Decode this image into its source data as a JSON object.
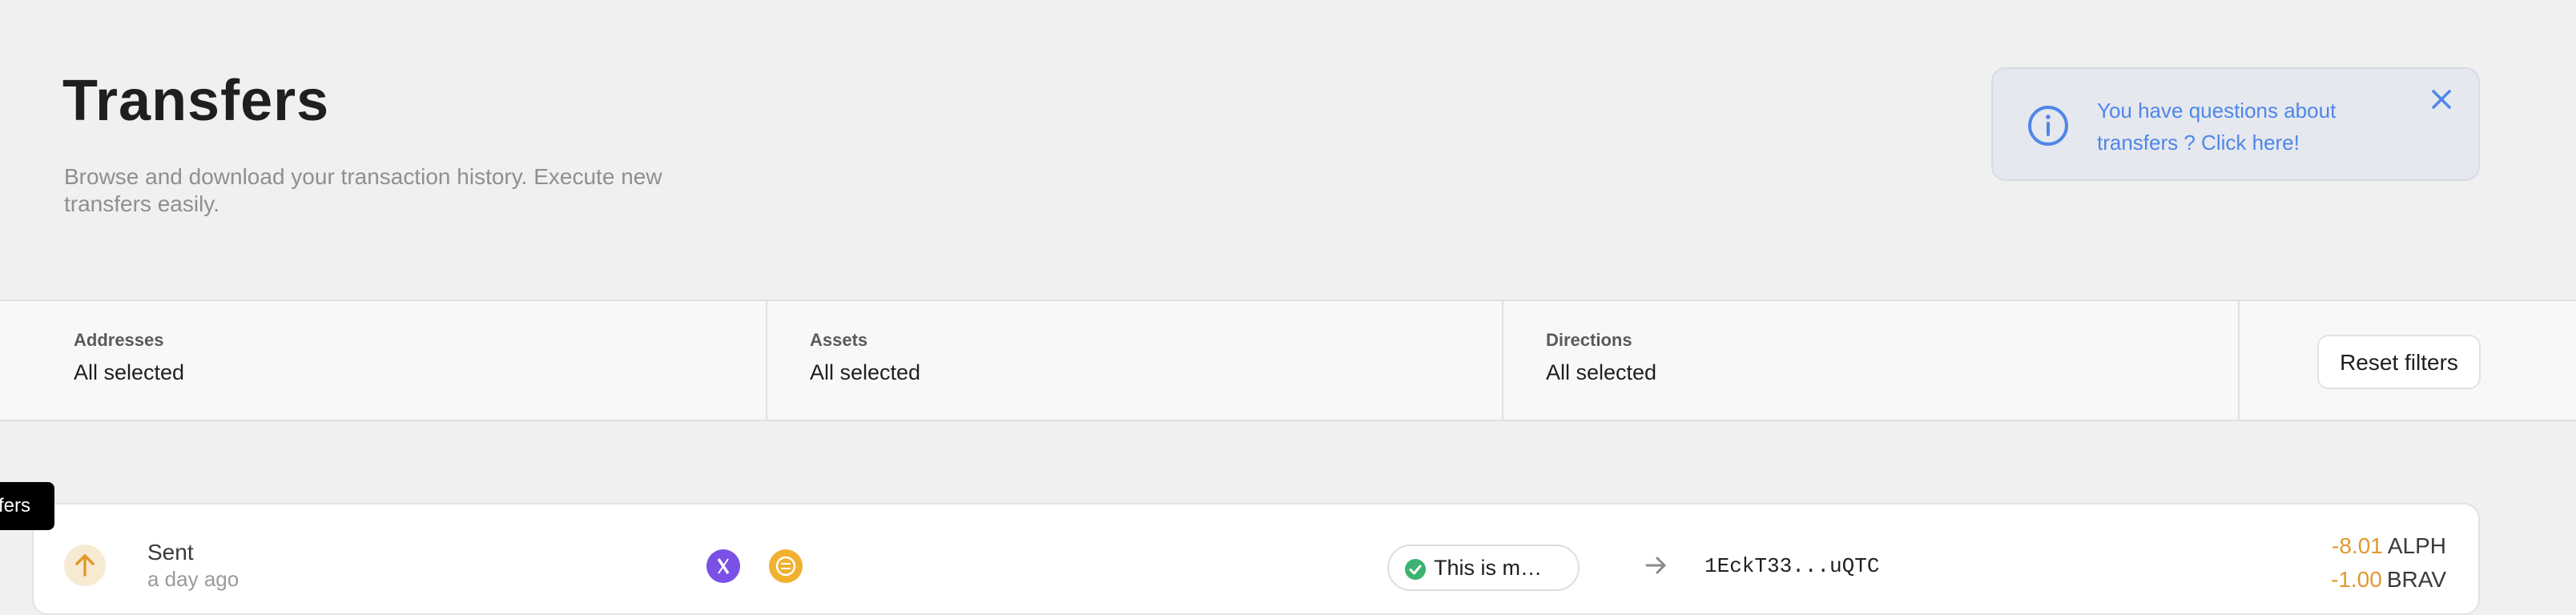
{
  "header": {
    "title": "Transfers",
    "subtitle": "Browse and download your transaction history. Execute new transfers easily."
  },
  "info_banner": {
    "text": "You have questions about transfers ? Click here!",
    "accent_color": "#4f86e8"
  },
  "filters": {
    "addresses": {
      "label": "Addresses",
      "value": "All selected"
    },
    "assets": {
      "label": "Assets",
      "value": "All selected"
    },
    "directions": {
      "label": "Directions",
      "value": "All selected"
    },
    "reset_label": "Reset filters"
  },
  "tooltip": {
    "text": "fers"
  },
  "transfers": [
    {
      "direction": "Sent",
      "time": "a day ago",
      "direction_icon": "arrow-up-icon",
      "assets": [
        "alph-token-icon",
        "token-b-icon"
      ],
      "from_address": "This is m…",
      "to_address": "1EckT33...uQTC",
      "amounts": [
        {
          "value": "-8.01",
          "symbol": "ALPH"
        },
        {
          "value": "-1.00",
          "symbol": "BRAV"
        }
      ]
    }
  ],
  "colors": {
    "background": "#f0f0f0",
    "negative_amount": "#e0992c",
    "success": "#3cb371"
  }
}
